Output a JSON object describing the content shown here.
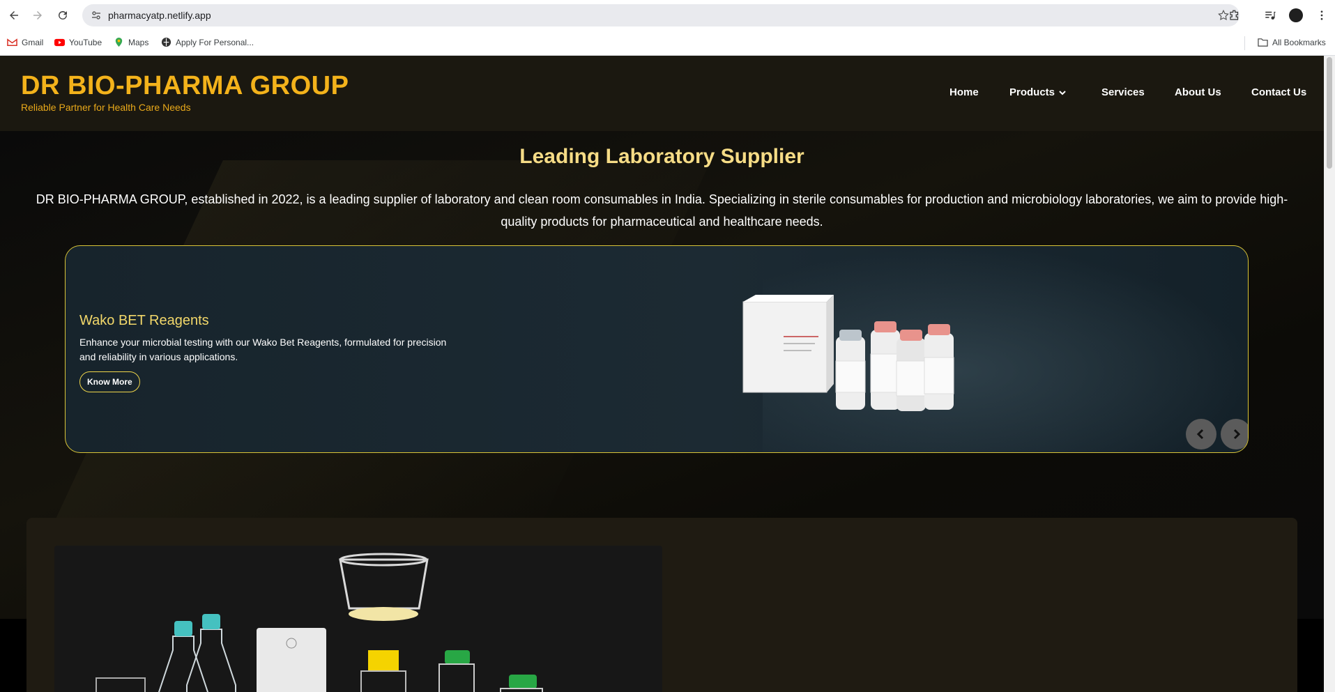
{
  "browser": {
    "url": "pharmacyatp.netlify.app",
    "bookmarks": [
      {
        "label": "Gmail",
        "icon": "gmail-icon"
      },
      {
        "label": "YouTube",
        "icon": "youtube-icon"
      },
      {
        "label": "Maps",
        "icon": "maps-icon"
      },
      {
        "label": "Apply For Personal...",
        "icon": "globe-icon"
      }
    ],
    "all_bookmarks": "All Bookmarks"
  },
  "header": {
    "brand_title": "DR BIO-PHARMA GROUP",
    "brand_tagline": "Reliable Partner for Health Care Needs",
    "nav": {
      "home": "Home",
      "products": "Products",
      "services": "Services",
      "about": "About Us",
      "contact": "Contact Us"
    }
  },
  "hero": {
    "title": "Leading Laboratory Supplier",
    "description": "DR BIO-PHARMA GROUP, established in 2022, is a leading supplier of laboratory and clean room consumables in India. Specializing in sterile consumables for production and microbiology laboratories, we aim to provide high-quality products for pharmaceutical and healthcare needs."
  },
  "carousel": {
    "slide_title": "Wako BET Reagents",
    "slide_text": "Enhance your microbial testing with our Wako Bet Reagents, formulated for precision and reliability in various applications.",
    "button_label": "Know More"
  },
  "colors": {
    "brand": "#f3b21b",
    "accent": "#f6dc86",
    "header_bg": "#1b1810",
    "carousel_border": "#d9c437"
  }
}
